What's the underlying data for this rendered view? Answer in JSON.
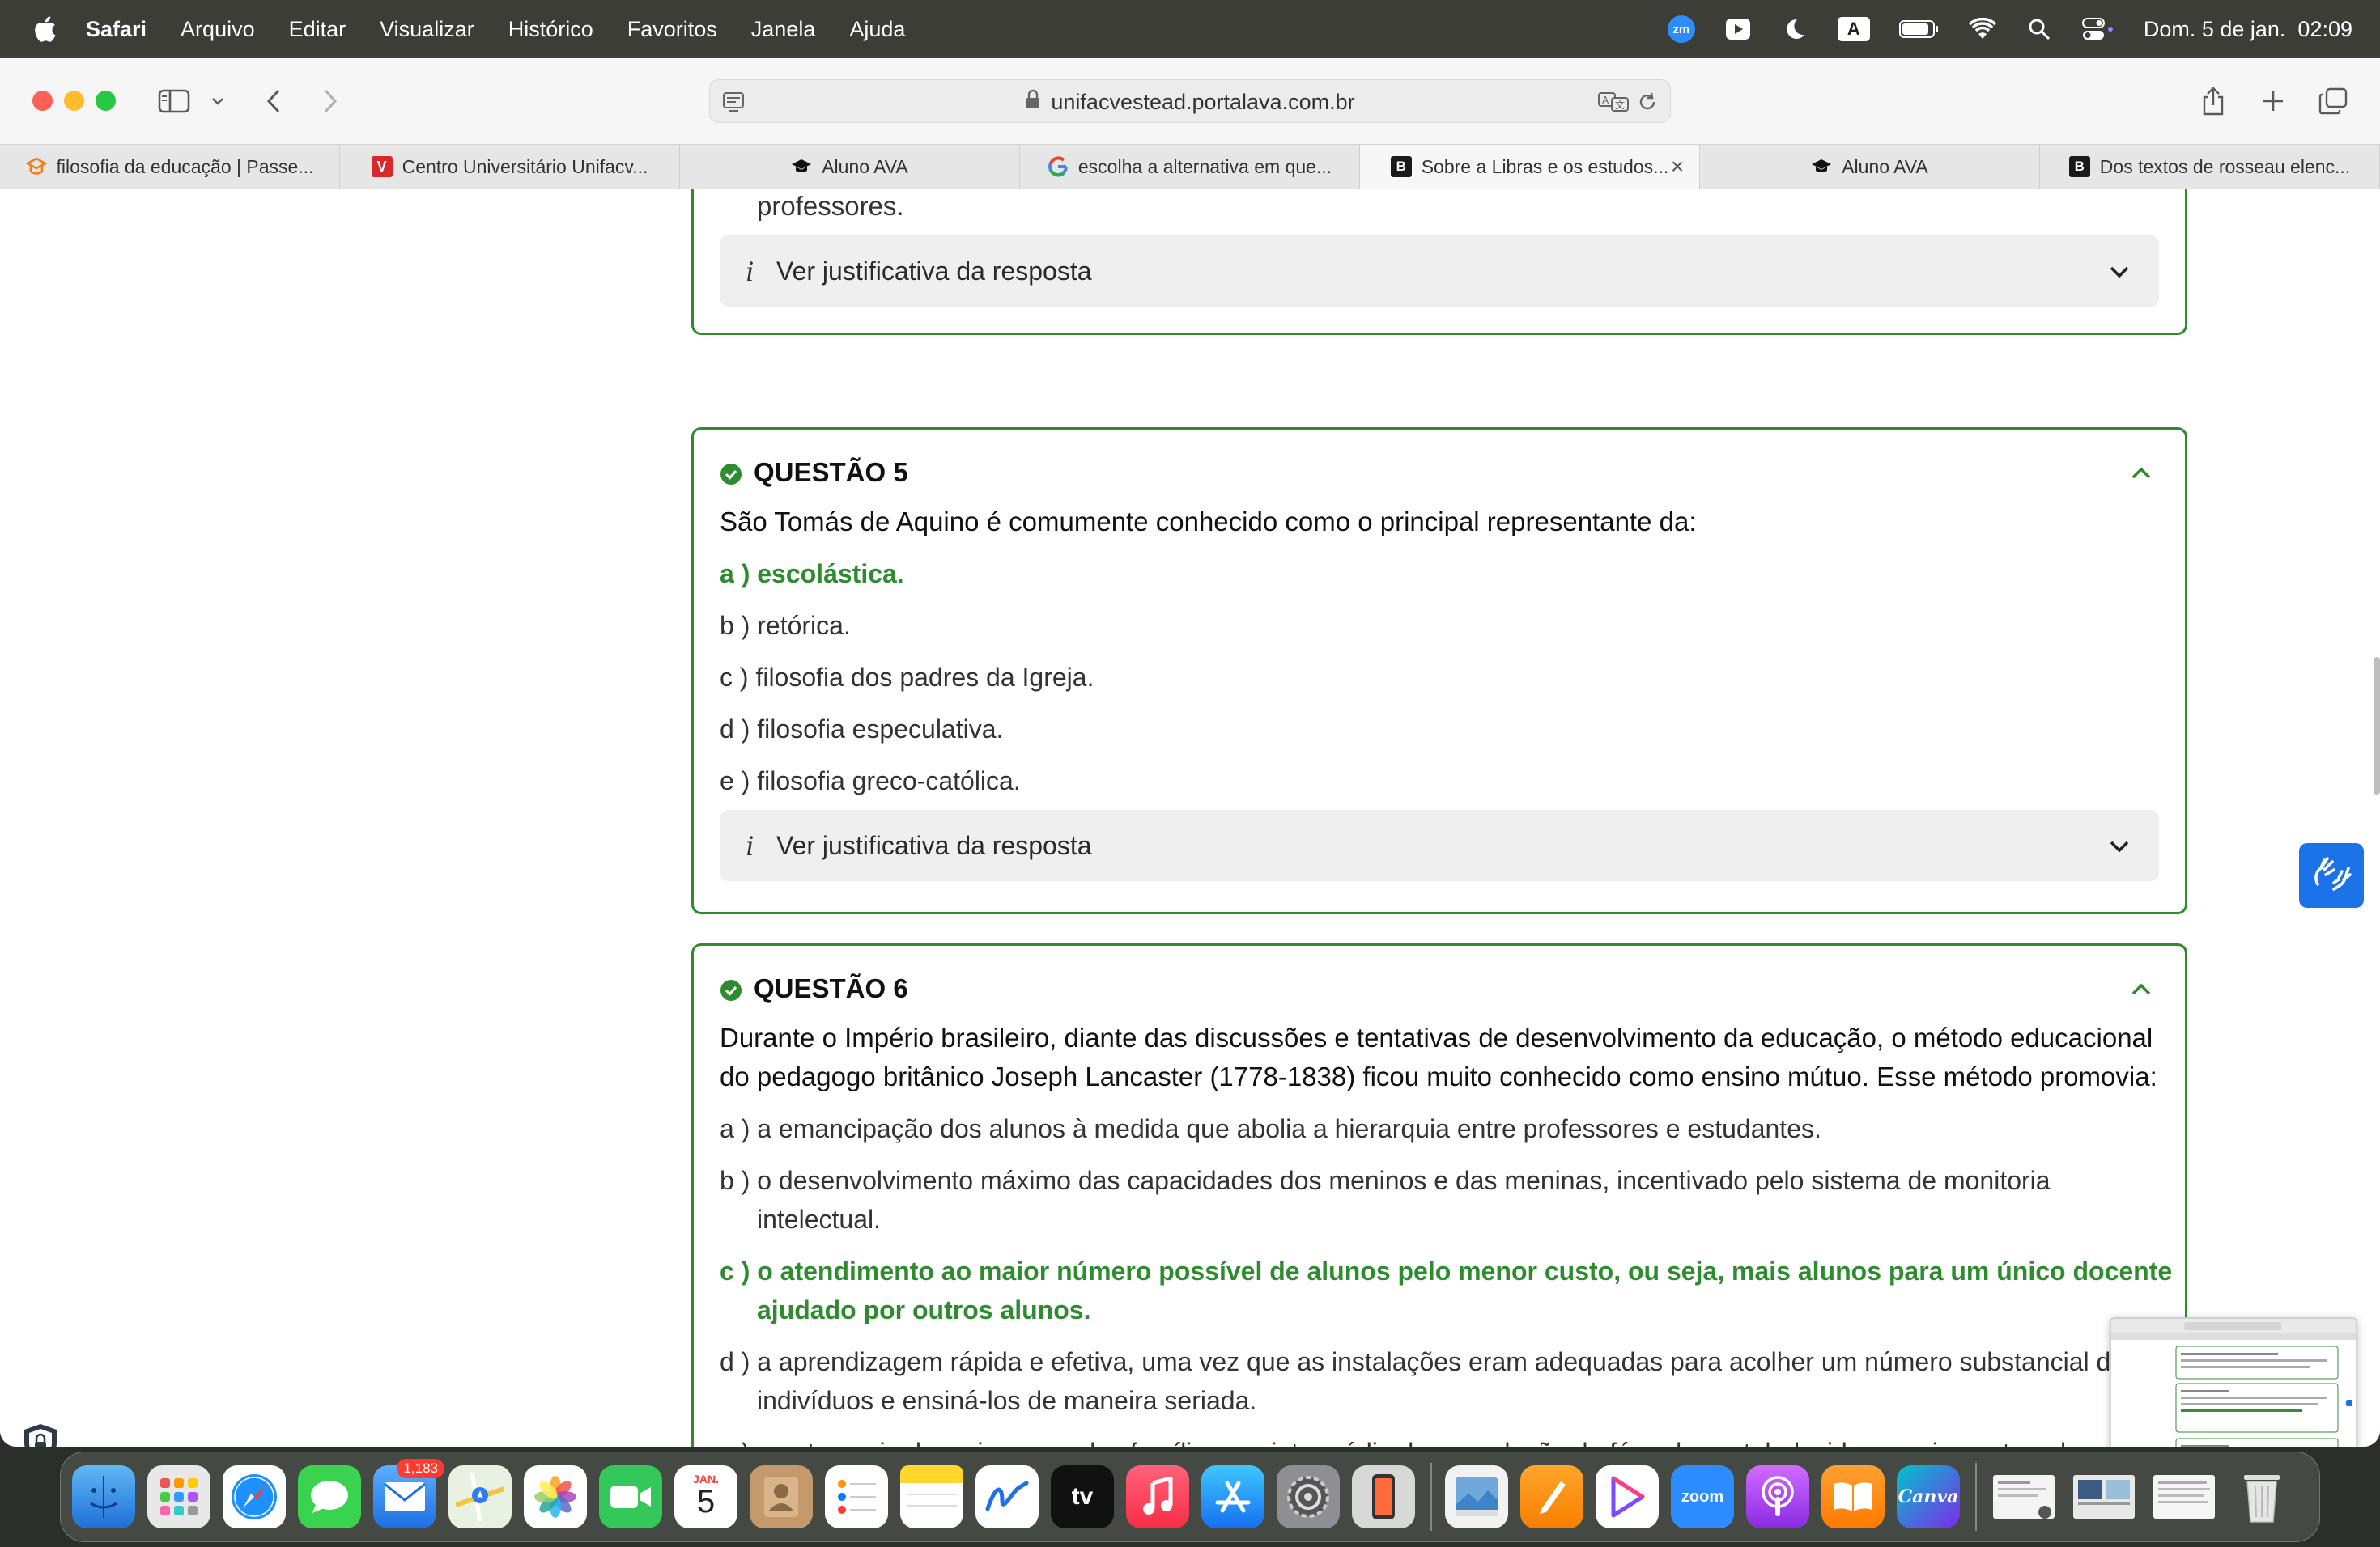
{
  "menubar": {
    "app_name": "Safari",
    "items": [
      "Arquivo",
      "Editar",
      "Visualizar",
      "Histórico",
      "Favoritos",
      "Janela",
      "Ajuda"
    ],
    "zoom_label": "zm",
    "input_source": "A",
    "clock": "Dom. 5 de jan.  02:09",
    "status_icons": [
      "zoom-icon",
      "play-icon",
      "moon-icon",
      "input-source-icon",
      "battery-icon",
      "wifi-icon",
      "search-icon",
      "control-center-icon"
    ]
  },
  "browser": {
    "url": "unifacvestead.portalava.com.br",
    "tabs": [
      {
        "title": "filosofia da educação | Passe...",
        "favicon": "passei-direto-icon",
        "active": false
      },
      {
        "title": "Centro Universitário Unifacv...",
        "favicon": "unifacvest-icon",
        "active": false
      },
      {
        "title": "Aluno AVA",
        "favicon": "graduation-cap-icon",
        "active": false
      },
      {
        "title": "escolha a alternativa em que...",
        "favicon": "google-icon",
        "active": false
      },
      {
        "title": "Sobre a Libras e os estudos...",
        "favicon": "brainly-icon",
        "active": true
      },
      {
        "title": "Aluno AVA",
        "favicon": "graduation-cap-icon",
        "active": false
      },
      {
        "title": "Dos textos de rosseau elenc...",
        "favicon": "brainly-icon",
        "active": false
      }
    ],
    "favicon_letters": {
      "unifacvest": "V",
      "brainly": "B",
      "google": "G"
    }
  },
  "page": {
    "prev_question_tail": "professores.",
    "justification_label": "Ver justificativa da resposta",
    "questions": [
      {
        "title": "QUESTÃO 5",
        "text": "São Tomás de Aquino é comumente conhecido como o principal representante da:",
        "options": [
          {
            "text": "a ) escolástica.",
            "correct": true
          },
          {
            "text": "b ) retórica.",
            "correct": false
          },
          {
            "text": "c ) filosofia dos padres da Igreja.",
            "correct": false
          },
          {
            "text": "d ) filosofia especulativa.",
            "correct": false
          },
          {
            "text": "e ) filosofia greco-católica.",
            "correct": false
          }
        ]
      },
      {
        "title": "QUESTÃO 6",
        "text": "Durante o Império brasileiro, diante das discussões e tentativas de desenvolvimento da educação, o método educacional do pedagogo britânico Joseph Lancaster (1778-1838) ficou muito conhecido como ensino mútuo. Esse método promovia:",
        "options": [
          {
            "text": "a ) a emancipação dos alunos à medida que abolia a hierarquia entre professores e estudantes.",
            "correct": false
          },
          {
            "text": "b ) o desenvolvimento máximo das capacidades dos meninos e das meninas, incentivado pelo sistema de monitoria intelectual.",
            "correct": false
          },
          {
            "text": "c ) o atendimento ao maior número possível de alunos pelo menor custo, ou seja, mais alunos para um único docente ajudado por outros alunos.",
            "correct": true
          },
          {
            "text": "d ) a aprendizagem rápida e efetiva, uma vez que as instalações eram adequadas para acolher um número substancial de indivíduos e ensiná-los de maneira seriada.",
            "correct": false
          },
          {
            "text": "e ) a autonomia das crianças e das famílias por intermédio da reprodução de fórmulas estabelecidas previamente pelo professor.",
            "correct": false
          }
        ]
      }
    ]
  },
  "dock": {
    "apps": [
      "Finder",
      "Launchpad",
      "Safari",
      "Messages",
      "Mail",
      "Maps",
      "Photos",
      "FaceTime",
      "Calendar",
      "Contacts",
      "Reminders",
      "Notes",
      "Freeform",
      "TV",
      "Music",
      "App Store",
      "System Settings",
      "iPhone Mirroring",
      "Preview",
      "Pages",
      "Infuse",
      "Zoom",
      "Podcasts",
      "Books",
      "Canva"
    ],
    "mail_badge": "1,183",
    "calendar_month": "JAN.",
    "calendar_day": "5",
    "tv_label": "tv",
    "zoom_label": "zoom",
    "canva_label": "Canva"
  },
  "colors": {
    "correct_green": "#2e8b2e",
    "menubar_bg": "#3b3d36",
    "accessibility_blue": "#1a73e8"
  }
}
